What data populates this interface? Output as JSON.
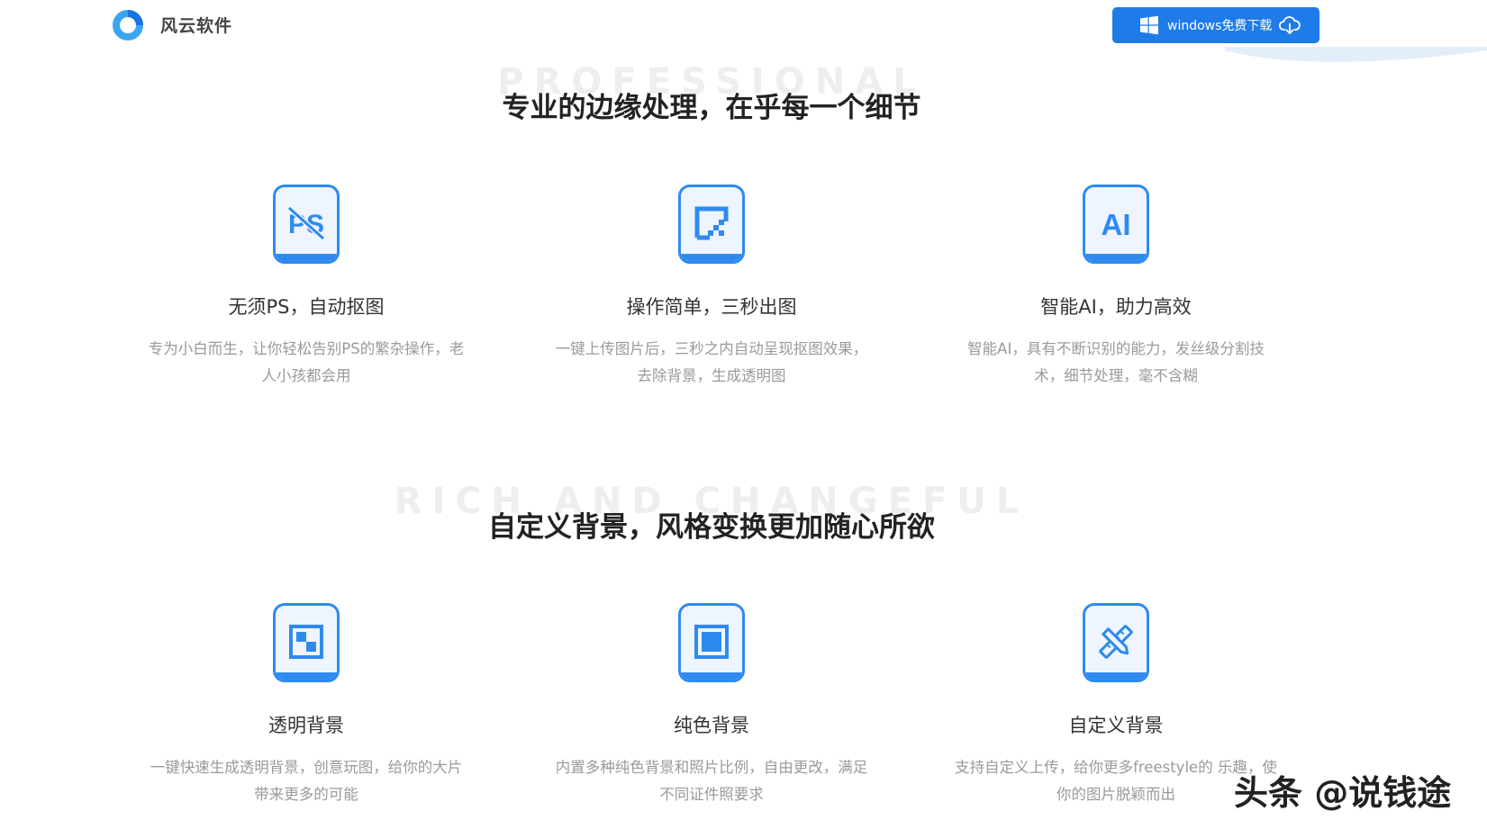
{
  "header": {
    "brand": "风云软件",
    "download_button": "windows免费下载"
  },
  "sections": [
    {
      "bg_word": "PROFESSIONAL",
      "title": "专业的边缘处理，在乎每一个细节",
      "features": [
        {
          "icon": "ps-crossed-icon",
          "title": "无须PS，自动抠图",
          "desc": "专为小白而生，让你轻松告别PS的繁杂操作，老人小孩都会用"
        },
        {
          "icon": "crop-square-icon",
          "title": "操作简单，三秒出图",
          "desc": "一键上传图片后，三秒之内自动呈现抠图效果，去除背景，生成透明图"
        },
        {
          "icon": "ai-text-icon",
          "title": "智能AI，助力高效",
          "desc": "智能AI，具有不断识别的能力，发丝级分割技术，细节处理，毫不含糊"
        }
      ]
    },
    {
      "bg_word": "RICH AND CHANGEFUL",
      "title": "自定义背景，风格变换更加随心所欲",
      "features": [
        {
          "icon": "transparent-grid-icon",
          "title": "透明背景",
          "desc": "一键快速生成透明背景，创意玩图，给你的大片带来更多的可能"
        },
        {
          "icon": "solid-square-icon",
          "title": "纯色背景",
          "desc": "内置多种纯色背景和照片比例，自由更改，满足不同证件照要求"
        },
        {
          "icon": "pencil-ruler-icon",
          "title": "自定义背景",
          "desc": "支持自定义上传，给你更多freestyle的 乐趣，使你的图片脱颖而出"
        }
      ]
    }
  ],
  "watermark": "头条 @说钱途",
  "colors": {
    "accent": "#1f7be8",
    "icon_blue": "#2f8af0",
    "title_text": "#222222",
    "desc_text": "#9a9a9a",
    "bg_word": "#eeeeee"
  }
}
